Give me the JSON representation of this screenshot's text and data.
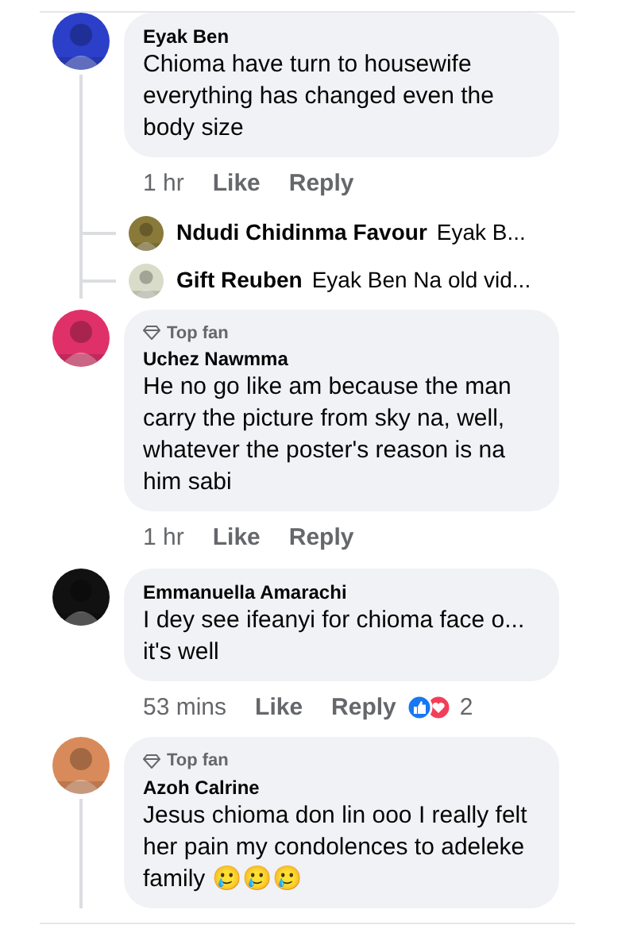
{
  "comments": [
    {
      "name": "Eyak Ben",
      "text": "Chioma have turn to housewife everything has changed even the body size",
      "time": "1 hr",
      "like": "Like",
      "reply": "Reply",
      "thread_continues": true,
      "replies": [
        {
          "name": "Ndudi Chidinma Favour",
          "preview": "Eyak B..."
        },
        {
          "name": "Gift Reuben",
          "preview": "Eyak Ben Na old vid..."
        }
      ]
    },
    {
      "badge": "Top fan",
      "name": "Uchez Nawmma",
      "text": "He no go like am because the man carry the picture from sky na, well, whatever the poster's reason is na him sabi",
      "time": "1 hr",
      "like": "Like",
      "reply": "Reply"
    },
    {
      "name": "Emmanuella Amarachi",
      "text": "I dey see ifeanyi for chioma face o... it's well",
      "time": "53 mins",
      "like": "Like",
      "reply": "Reply",
      "reactions": {
        "count": "2"
      }
    },
    {
      "badge": "Top fan",
      "name": "Azoh Calrine",
      "text": "Jesus chioma don lin ooo I really felt her pain my condolences to adeleke family 🥲🥲🥲",
      "thread_continues": true
    }
  ]
}
